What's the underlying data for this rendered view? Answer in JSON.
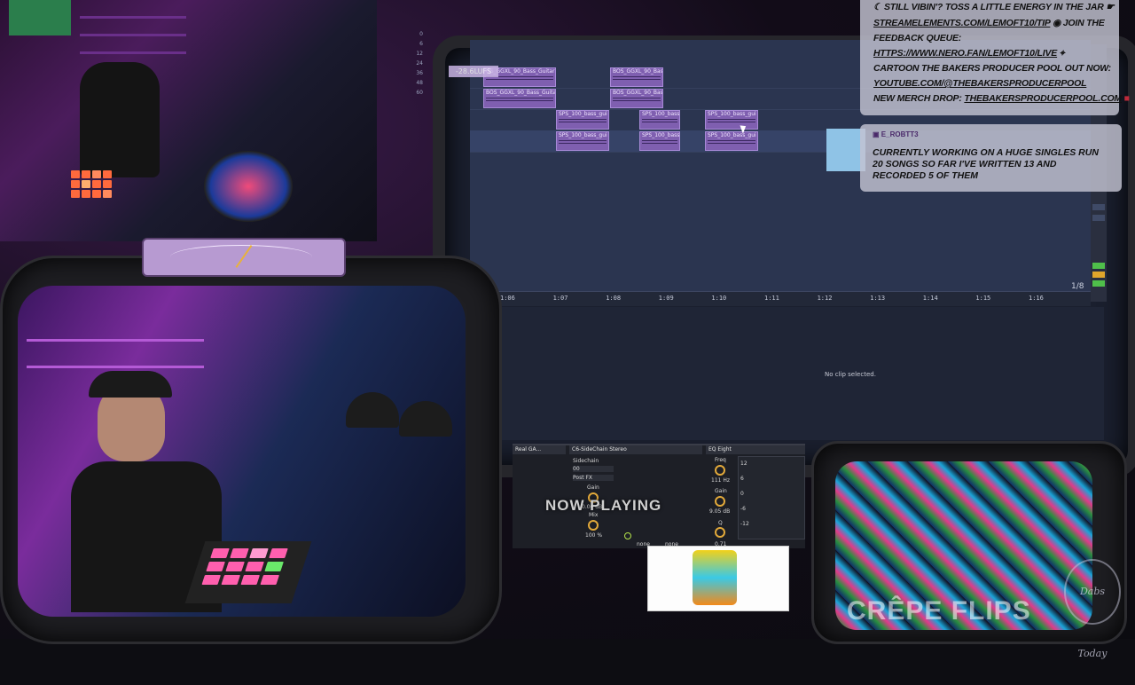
{
  "chat": {
    "lines": [
      {
        "icon": "moon-icon",
        "text": "STILL VIBIN'? TOSS A LITTLE ENERGY IN THE JAR"
      },
      {
        "text": "STREAMELEMENTS.COM/LEMOFT10/TIP",
        "link": true,
        "suffix": "JOIN THE"
      },
      {
        "text": "FEEDBACK QUEUE:"
      },
      {
        "text": "HTTPS://WWW.NERO.FAN/LEMOFT10/LIVE",
        "link": true
      },
      {
        "text": "CARTOON THE BAKERS PRODUCER POOL OUT NOW:"
      },
      {
        "text": "YOUTUBE.COM/@THEBAKERSPRODUCERPOOL",
        "link": true
      },
      {
        "text": "NEW MERCH DROP: ",
        "link_part": "THEBAKERSPRODUCERPOOL.COM"
      }
    ],
    "message": {
      "user": "E_ROBTT3",
      "text": "CURRENTLY WORKING ON A HUGE SINGLES RUN 20 SONGS SO FAR I'VE WRITTEN 13 AND RECORDED 5 OF THEM"
    }
  },
  "daw": {
    "lufs_label": "-28.6LUFS",
    "clips": [
      {
        "label": "OS_GGXL_90_Bass_Guitar",
        "lane": 0,
        "col": 0
      },
      {
        "label": "BOS_GGXL_90_Bas",
        "lane": 0,
        "col": 1
      },
      {
        "label": "BOS_GGXL_90_Bass_Guitar",
        "lane": 1,
        "col": 0
      },
      {
        "label": "BOS_GGXL_90_Bas",
        "lane": 1,
        "col": 1
      },
      {
        "label": "SPS_100_bass_gui",
        "lane": 2,
        "col": 2
      },
      {
        "label": "SPS_100_bass",
        "lane": 2,
        "col": 3
      },
      {
        "label": "SPS_100_bass_gui",
        "lane": 2,
        "col": 4
      },
      {
        "label": "SPS_100_bass_gui",
        "lane": 3,
        "col": 2
      },
      {
        "label": "SPS_100_bass",
        "lane": 3,
        "col": 3
      },
      {
        "label": "SPS_100_bass_gui",
        "lane": 3,
        "col": 4
      }
    ],
    "ruler_ticks": [
      "1:06",
      "1:07",
      "1:08",
      "1:09",
      "1:10",
      "1:11",
      "1:12",
      "1:13",
      "1:14",
      "1:15",
      "1:16"
    ],
    "zoom": "1/8",
    "no_clip": "No clip selected.",
    "db_scale": [
      "0",
      "6",
      "12",
      "24",
      "36",
      "48",
      "60"
    ]
  },
  "devices": {
    "dev1_title": "Real GA...",
    "dev2_title": "C6-SideChain Stereo",
    "dev3_title": "EQ Eight",
    "sidechain_label": "Sidechain",
    "sidechain_value": "00",
    "postfx_label": "Post FX",
    "gain_label": "Gain",
    "gain_value": "0.00 dB",
    "mix_label": "Mix",
    "mix_value": "100 %",
    "freq_label": "Freq",
    "freq_value": "111 Hz",
    "eq_gain_label": "Gain",
    "eq_gain_value": "9.05 dB",
    "q_label": "Q",
    "q_value": "0.71",
    "none_1": "none",
    "none_2": "none",
    "eq_scale": [
      "12",
      "6",
      "0",
      "-6",
      "-12"
    ]
  },
  "now_playing": "NOW PLAYING",
  "visualizer_text": "CRÊPE FLIPS",
  "brand": "Dabs Today"
}
